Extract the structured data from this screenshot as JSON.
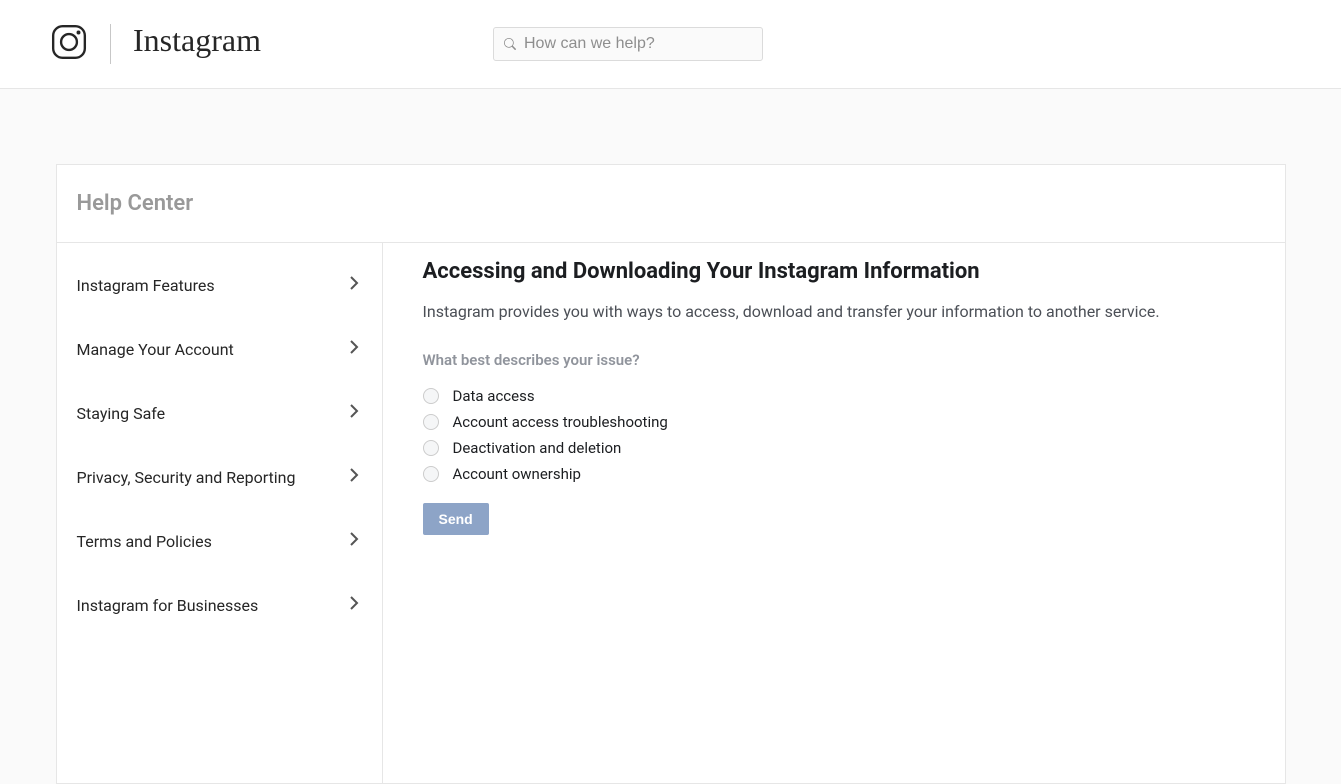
{
  "header": {
    "brand_name": "Instagram",
    "search_placeholder": "How can we help?"
  },
  "help_center": {
    "title": "Help Center",
    "nav": [
      {
        "label": "Instagram Features"
      },
      {
        "label": "Manage Your Account"
      },
      {
        "label": "Staying Safe"
      },
      {
        "label": "Privacy, Security and Reporting"
      },
      {
        "label": "Terms and Policies"
      },
      {
        "label": "Instagram for Businesses"
      }
    ]
  },
  "article": {
    "title": "Accessing and Downloading Your Instagram Information",
    "intro": "Instagram provides you with ways to access, download and transfer your information to another service.",
    "question": "What best describes your issue?",
    "options": [
      {
        "label": "Data access"
      },
      {
        "label": "Account access troubleshooting"
      },
      {
        "label": "Deactivation and deletion"
      },
      {
        "label": "Account ownership"
      }
    ],
    "send_label": "Send"
  }
}
